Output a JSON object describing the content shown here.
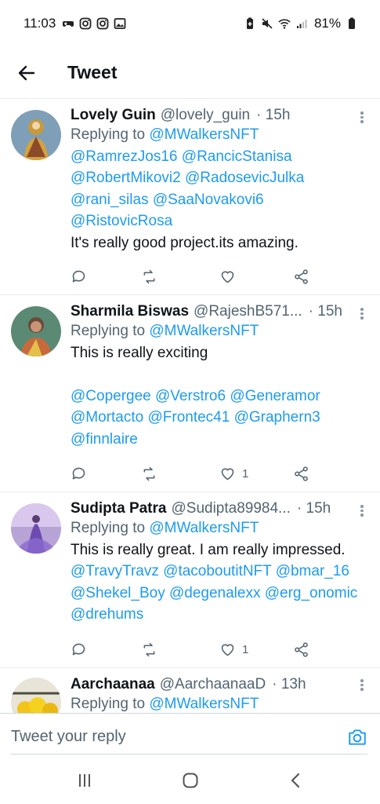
{
  "status_bar": {
    "time": "11:03",
    "battery": "81%",
    "left_icons": [
      "game-icon",
      "instagram-icon",
      "instagram-icon",
      "image-icon"
    ],
    "right_icons": [
      "battery-saver-icon",
      "mute-icon",
      "wifi-icon",
      "signal-icon",
      "battery-icon"
    ]
  },
  "header": {
    "title": "Tweet"
  },
  "tweets": [
    {
      "name": "Lovely Guin",
      "handle": "@lovely_guin",
      "time": "· 15h",
      "replying_prefix": "Replying to",
      "replying_to": "@MWalkersNFT",
      "mention_lines": [
        "@RamrezJos16 @RancicStanisa",
        "@RobertMikovi2 @RadosevicJulka",
        "@rani_silas @SaaNovakovi6",
        "@RistovicRosa"
      ],
      "text": "It's really good project.its amazing.",
      "likes": ""
    },
    {
      "name": "Sharmila Biswas",
      "handle": "@RajeshB571...",
      "time": "· 15h",
      "replying_prefix": "Replying to",
      "replying_to": "@MWalkersNFT",
      "text": "This is really exciting",
      "mention_lines": [
        "@Copergee @Verstro6 @Generamor",
        "@Mortacto @Frontec41 @Graphern3",
        "@finnlaire"
      ],
      "likes": "1"
    },
    {
      "name": "Sudipta Patra",
      "handle": "@Sudipta89984...",
      "time": "· 15h",
      "replying_prefix": "Replying to",
      "replying_to": "@MWalkersNFT",
      "text": "This is really great. I am really impressed.",
      "mention_lines": [
        "@TravyTravz @tacoboutitNFT @bmar_16",
        "@Shekel_Boy @degenalexx @erg_onomic",
        "@drehums"
      ],
      "likes": "1"
    },
    {
      "name": "Aarchaanaa",
      "handle": "@AarchaanaaD",
      "time": "· 13h",
      "replying_prefix": "Replying to",
      "replying_to": "@MWalkersNFT"
    }
  ],
  "reply_bar": {
    "placeholder": "Tweet your reply"
  },
  "colors": {
    "accent": "#1d9bf0",
    "text": "#0f1419",
    "muted": "#536471",
    "divider": "#e6ecf0"
  }
}
